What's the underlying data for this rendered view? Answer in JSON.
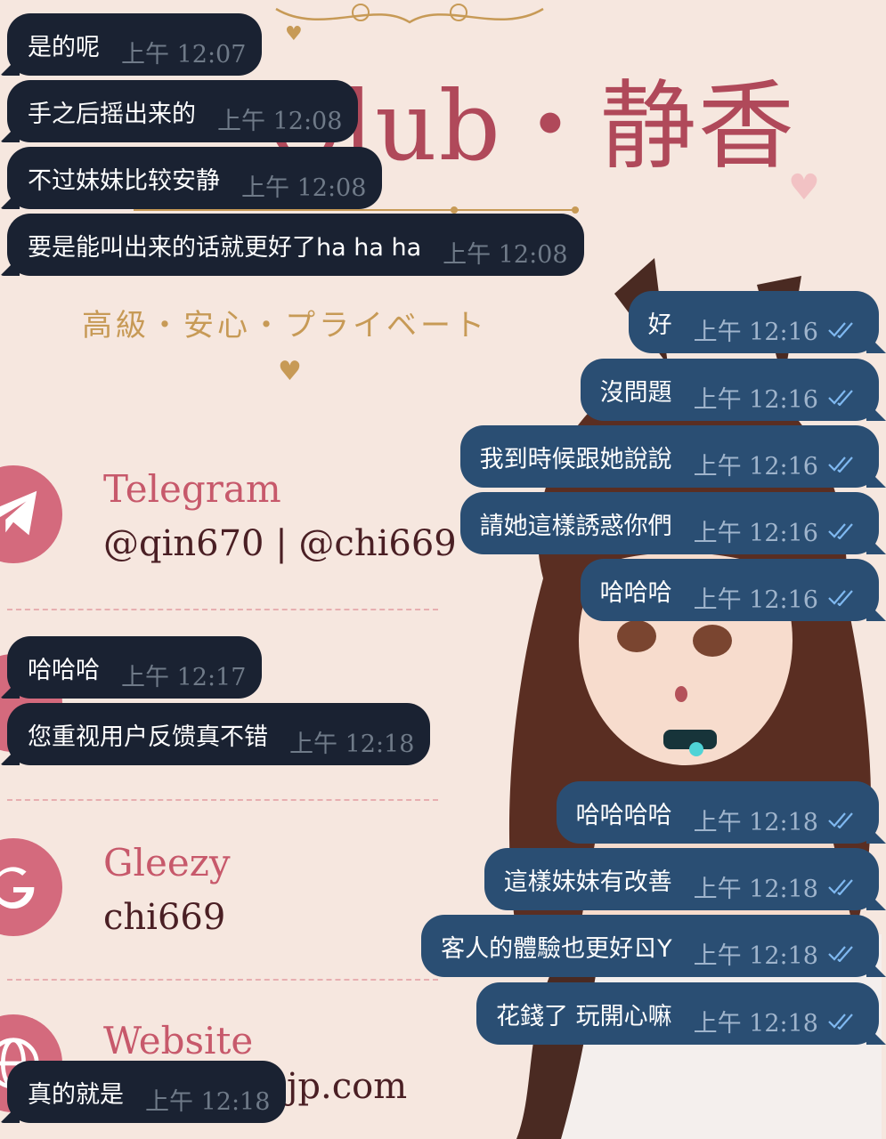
{
  "background": {
    "title": "Club・静香",
    "tagline": "高級・安心・プライベート",
    "contacts": [
      {
        "label": "Telegram",
        "value": "@qin670 | @chi669",
        "icon": "telegram-icon"
      },
      {
        "label": "Gleezy",
        "value": "chi669",
        "icon": "g-letter-icon"
      },
      {
        "label": "Website",
        "value": "jp.com",
        "icon": "globe-icon"
      }
    ],
    "colors": {
      "accent": "#b0495a",
      "gold": "#c79a56",
      "icon_bg": "#d46a7d"
    }
  },
  "chat": {
    "colors": {
      "incoming_bubble": "#1a2232",
      "outgoing_bubble": "#2a4e73",
      "read_check": "#7fb8f0"
    },
    "messages": [
      {
        "dir": "in",
        "text": "是的呢",
        "time": "上午 12:07"
      },
      {
        "dir": "in",
        "text": "手之后摇出来的",
        "time": "上午 12:08"
      },
      {
        "dir": "in",
        "text": "不过妹妹比较安静",
        "time": "上午 12:08"
      },
      {
        "dir": "in",
        "text": "要是能叫出来的话就更好了ha ha ha",
        "time": "上午 12:08"
      },
      {
        "dir": "out",
        "text": "好",
        "time": "上午 12:16",
        "status": "read"
      },
      {
        "dir": "out",
        "text": "沒問題",
        "time": "上午 12:16",
        "status": "read"
      },
      {
        "dir": "out",
        "text": "我到時候跟她說說",
        "time": "上午 12:16",
        "status": "read"
      },
      {
        "dir": "out",
        "text": "請她這樣誘惑你們",
        "time": "上午 12:16",
        "status": "read"
      },
      {
        "dir": "out",
        "text": "哈哈哈",
        "time": "上午 12:16",
        "status": "read"
      },
      {
        "dir": "in",
        "text": "哈哈哈",
        "time": "上午 12:17"
      },
      {
        "dir": "in",
        "text": "您重视用户反馈真不错",
        "time": "上午 12:18"
      },
      {
        "dir": "out",
        "text": "哈哈哈哈",
        "time": "上午 12:18",
        "status": "read"
      },
      {
        "dir": "out",
        "text": "這樣妹妹有改善",
        "time": "上午 12:18",
        "status": "read"
      },
      {
        "dir": "out",
        "text": "客人的體驗也更好ㄖY",
        "time": "上午 12:18",
        "status": "read"
      },
      {
        "dir": "out",
        "text": "花錢了 玩開心嘛",
        "time": "上午 12:18",
        "status": "read"
      },
      {
        "dir": "in",
        "text": "真的就是",
        "time": "上午 12:18"
      }
    ]
  }
}
